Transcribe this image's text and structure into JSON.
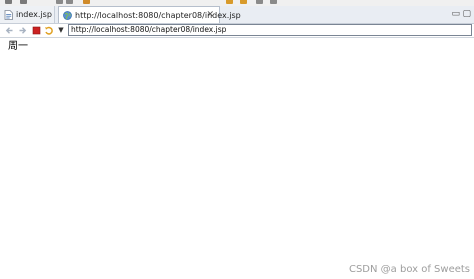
{
  "tabs": [
    {
      "label": "index.jsp",
      "icon": "jsp-file-icon"
    },
    {
      "label": "http://localhost:8080/chapter08/index.jsp",
      "icon": "globe-icon"
    }
  ],
  "navigation": {
    "url": "http://localhost:8080/chapter08/index.jsp"
  },
  "page": {
    "text": "周一"
  },
  "watermark": "CSDN @a box of Sweets",
  "colors": {
    "stop": "#cc2222",
    "refresh": "#e0a020",
    "globe": "#2f6fb0"
  }
}
